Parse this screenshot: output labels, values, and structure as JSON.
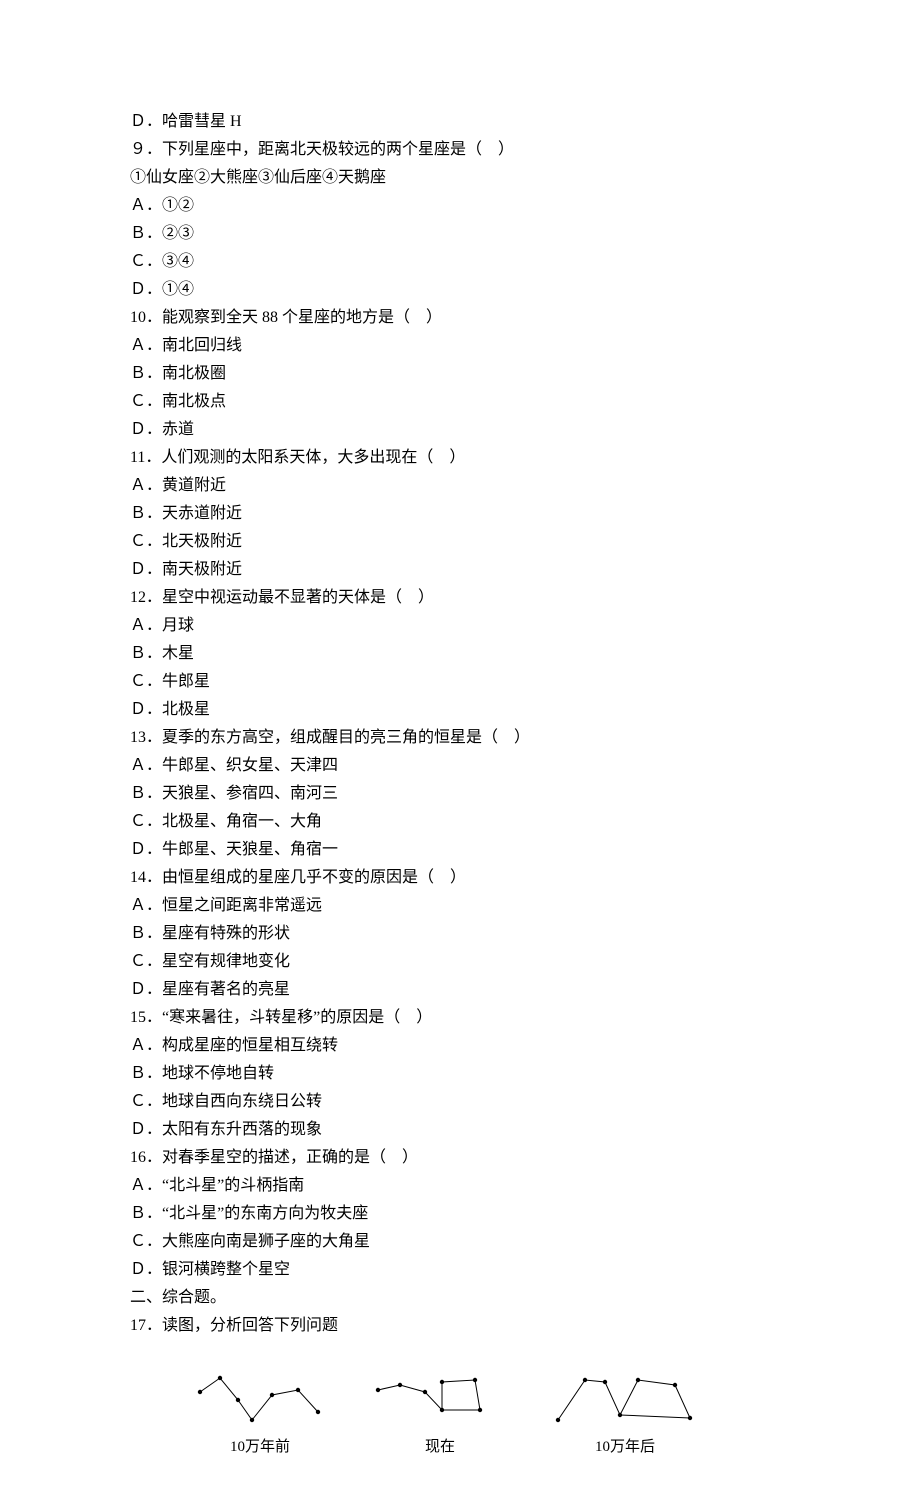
{
  "lines": {
    "l8d": "Ｄ．哈雷彗星 H",
    "l9q": "９．下列星座中，距离北天极较远的两个星座是（　）",
    "l9s": "①仙女座②大熊座③仙后座④天鹅座",
    "l9a": "Ａ．①②",
    "l9b": "Ｂ．②③",
    "l9c": "Ｃ．③④",
    "l9d": "Ｄ．①④",
    "l10q": "10．能观察到全天 88 个星座的地方是（　）",
    "l10a": "Ａ．南北回归线",
    "l10b": "Ｂ．南北极圈",
    "l10c": "Ｃ．南北极点",
    "l10d": "Ｄ．赤道",
    "l11q": "11．人们观测的太阳系天体，大多出现在（　）",
    "l11a": "Ａ．黄道附近",
    "l11b": "Ｂ．天赤道附近",
    "l11c": "Ｃ．北天极附近",
    "l11d": "Ｄ．南天极附近",
    "l12q": "12．星空中视运动最不显著的天体是（　）",
    "l12a": "Ａ．月球",
    "l12b": "Ｂ．木星",
    "l12c": "Ｃ．牛郎星",
    "l12d": "Ｄ．北极星",
    "l13q": "13．夏季的东方高空，组成醒目的亮三角的恒星是（　）",
    "l13a": "Ａ．牛郎星、织女星、天津四",
    "l13b": "Ｂ．天狼星、参宿四、南河三",
    "l13c": "Ｃ．北极星、角宿一、大角",
    "l13d": "Ｄ．牛郎星、天狼星、角宿一",
    "l14q": "14．由恒星组成的星座几乎不变的原因是（　）",
    "l14a": "Ａ．恒星之间距离非常遥远",
    "l14b": "Ｂ．星座有特殊的形状",
    "l14c": "Ｃ．星空有规律地变化",
    "l14d": "Ｄ．星座有著名的亮星",
    "l15q": "15．“寒来暑往，斗转星移”的原因是（　）",
    "l15a": "Ａ．构成星座的恒星相互绕转",
    "l15b": "Ｂ．地球不停地自转",
    "l15c": "Ｃ．地球自西向东绕日公转",
    "l15d": "Ｄ．太阳有东升西落的现象",
    "l16q": "16．对春季星空的描述，正确的是（　）",
    "l16a": "Ａ．“北斗星”的斗柄指南",
    "l16b": "Ｂ．“北斗星”的东南方向为牧夫座",
    "l16c": "Ｃ．大熊座向南是狮子座的大角星",
    "l16d": "Ｄ．银河横跨整个星空",
    "sec2": "二、综合题。",
    "l17q": "17．读图，分析回答下列问题"
  },
  "diagram": {
    "cap1": "10万年前",
    "cap2": "现在",
    "cap3": "10万年后"
  }
}
